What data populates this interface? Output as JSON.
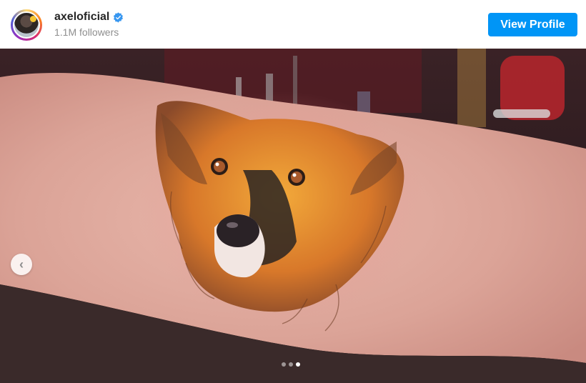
{
  "profile": {
    "username": "axeloficial",
    "verified": true,
    "followers": "1.1M followers",
    "view_profile_label": "View Profile"
  },
  "post": {
    "image_description_icon": "photo-tattoo-dog-portrait",
    "carousel": {
      "prev_icon": "chevron-left-icon",
      "total_slides": 3,
      "active_slide": 3
    }
  },
  "colors": {
    "accent": "#0095f6",
    "username": "#262626",
    "secondary_text": "#8e8e8e",
    "verified_badge": "#3897f0"
  }
}
